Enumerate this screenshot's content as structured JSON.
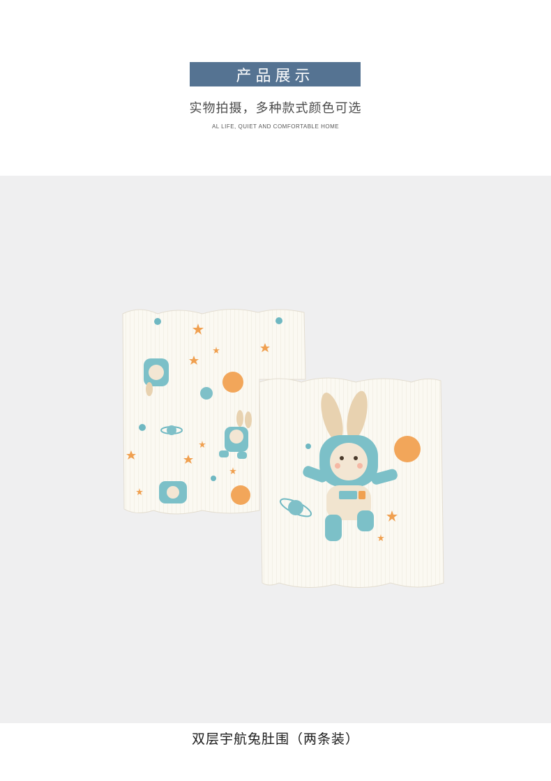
{
  "header": {
    "title": "产品展示",
    "subtitle": "实物拍摄，多种款式颜色可选",
    "tagline": "AL LIFE, QUIET AND COMFORTABLE HOME"
  },
  "product": {
    "caption": "双层宇航兔肚围（两条装）"
  },
  "colors": {
    "banner": "#557392",
    "photo_background": "#efeff0",
    "fabric": "#fbf9f2",
    "print_blue": "#6fb8c2",
    "print_orange": "#f0a050"
  }
}
